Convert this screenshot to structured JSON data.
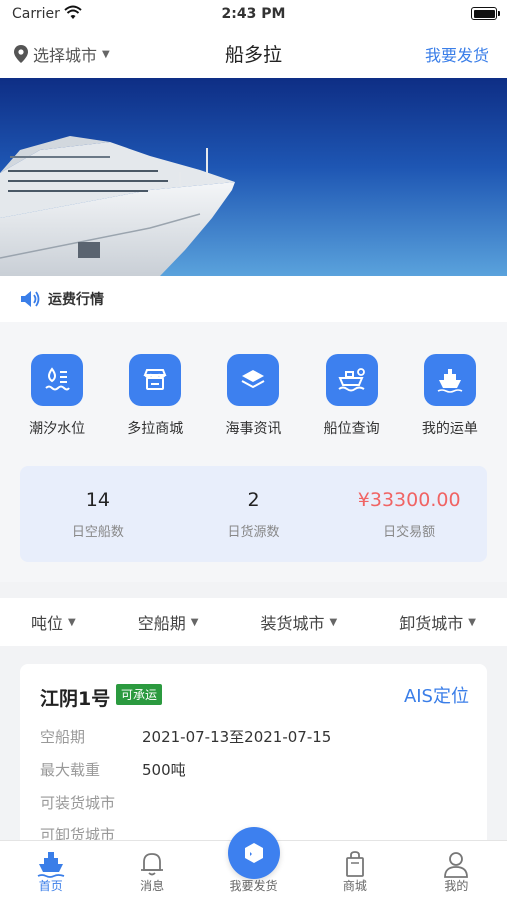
{
  "status_bar": {
    "carrier": "Carrier",
    "time": "2:43 PM"
  },
  "nav": {
    "city_label": "选择城市",
    "title": "船多拉",
    "ship_button": "我要发货"
  },
  "freight": {
    "label": "运费行情"
  },
  "menu": [
    {
      "label": "潮汐水位",
      "icon": "tide-level-icon"
    },
    {
      "label": "多拉商城",
      "icon": "mall-icon"
    },
    {
      "label": "海事资讯",
      "icon": "news-icon"
    },
    {
      "label": "船位查询",
      "icon": "ship-position-icon"
    },
    {
      "label": "我的运单",
      "icon": "waybill-icon"
    }
  ],
  "stats": [
    {
      "value": "14",
      "label": "日空船数"
    },
    {
      "value": "2",
      "label": "日货源数"
    },
    {
      "value": "¥33300.00",
      "label": "日交易额"
    }
  ],
  "filters": [
    {
      "label": "吨位"
    },
    {
      "label": "空船期"
    },
    {
      "label": "装货城市"
    },
    {
      "label": "卸货城市"
    }
  ],
  "ship_card": {
    "name": "江阴1号",
    "badge": "可承运",
    "ais_label": "AIS定位",
    "rows": [
      {
        "key": "空船期",
        "value": "2021-07-13至2021-07-15"
      },
      {
        "key": "最大载重",
        "value": "500吨"
      },
      {
        "key": "可装货城市",
        "value": ""
      },
      {
        "key": "可卸货城市",
        "value": ""
      }
    ]
  },
  "tabbar": [
    {
      "label": "首页",
      "icon": "home-ship-icon"
    },
    {
      "label": "消息",
      "icon": "bell-icon"
    },
    {
      "label": "我要发货",
      "icon": "box-icon"
    },
    {
      "label": "商城",
      "icon": "shopping-bag-icon"
    },
    {
      "label": "我的",
      "icon": "user-icon"
    }
  ],
  "colors": {
    "accent": "#3a7ee8",
    "tile": "#3d80ef",
    "money": "#f06464",
    "badge": "#2b9a3f"
  }
}
